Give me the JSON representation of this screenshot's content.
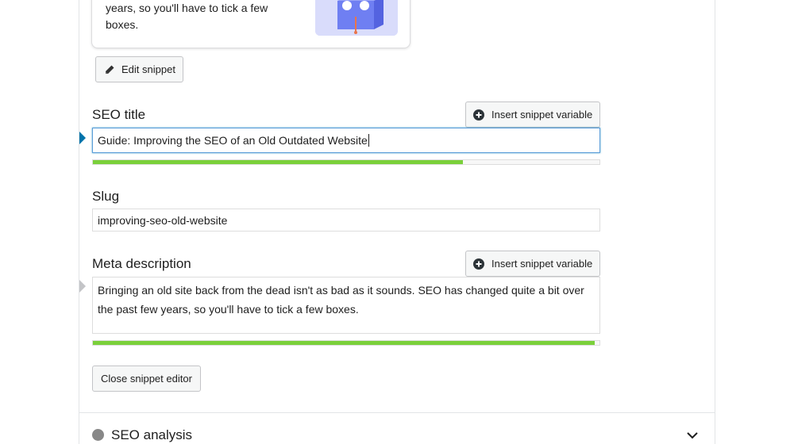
{
  "preview": {
    "text_line1": "years, so you'll have to tick a few",
    "text_line2": "boxes."
  },
  "buttons": {
    "edit_snippet": "Edit snippet",
    "insert_snippet_variable": "Insert snippet variable",
    "close_snippet_editor": "Close snippet editor"
  },
  "seo_title": {
    "label": "SEO title",
    "value": "Guide: Improving the SEO of an Old Outdated Website",
    "progress_percent": 73,
    "marker_color": "#0073aa"
  },
  "slug": {
    "label": "Slug",
    "value": "improving-seo-old-website"
  },
  "meta_description": {
    "label": "Meta description",
    "value": "Bringing an old site back from the dead isn't as bad as it sounds. SEO has changed quite a bit over the past few years, so you'll have to tick a few boxes.",
    "progress_percent": 99,
    "marker_color": "#c3c4c7"
  },
  "analysis": {
    "label": "SEO analysis",
    "status_color": "#888888"
  },
  "colors": {
    "progress_good": "#7ad03a",
    "focus_border": "#5b9dd9"
  }
}
